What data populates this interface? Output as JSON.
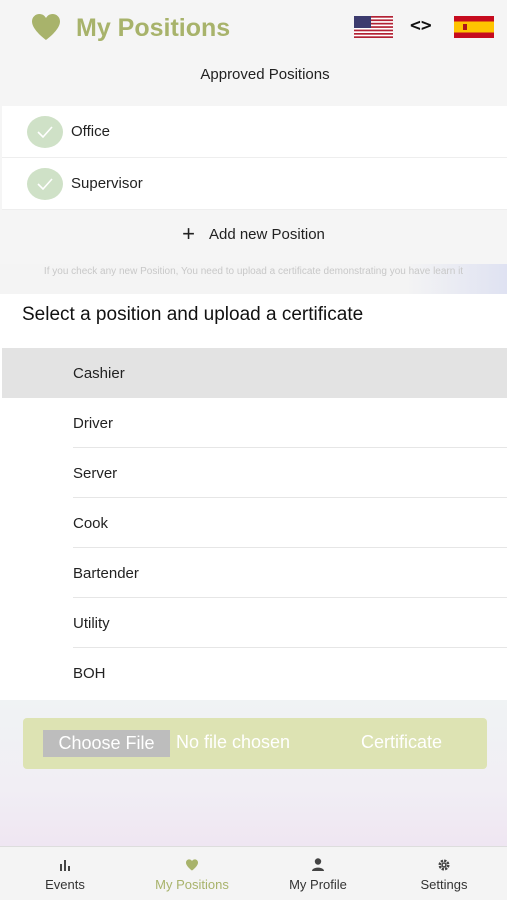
{
  "header": {
    "title": "My Positions",
    "brand_color": "#a8b36b",
    "code_symbol": "<>"
  },
  "approved": {
    "subtitle": "Approved Positions",
    "items": [
      {
        "label": "Office"
      },
      {
        "label": "Supervisor"
      }
    ]
  },
  "add_position": {
    "plus": "+",
    "label": "Add new Position"
  },
  "notice": "If you check any new Position, You need to upload a certificate demonstrating you have learn it",
  "selection": {
    "heading": "Select a position and upload a certificate",
    "positions": [
      {
        "label": "Cashier",
        "selected": true
      },
      {
        "label": "Driver"
      },
      {
        "label": "Server"
      },
      {
        "label": "Cook"
      },
      {
        "label": "Bartender"
      },
      {
        "label": "Utility"
      },
      {
        "label": "BOH"
      }
    ]
  },
  "upload": {
    "button_label": "Choose File",
    "status": "No file chosen",
    "field_label": "Certificate"
  },
  "tabs": [
    {
      "label": "Events",
      "icon": "chart-icon"
    },
    {
      "label": "My Positions",
      "icon": "heart-icon",
      "active": true
    },
    {
      "label": "My Profile",
      "icon": "person-icon"
    },
    {
      "label": "Settings",
      "icon": "gear-icon"
    }
  ]
}
